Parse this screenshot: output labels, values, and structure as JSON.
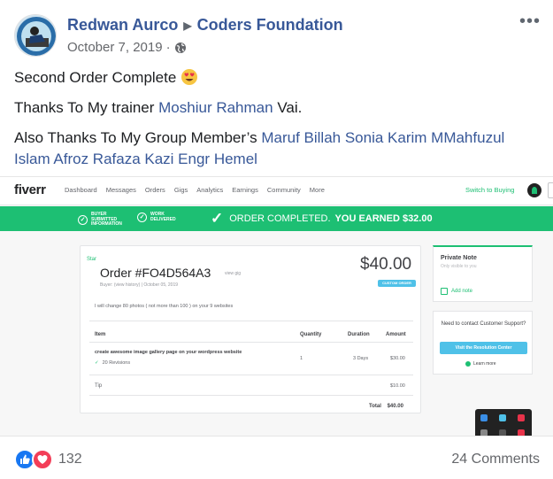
{
  "post": {
    "author": "Redwan Aurco",
    "group": "Coders Foundation",
    "date": "October 7, 2019",
    "separator": "·",
    "line1": "Second Order Complete",
    "line2_prefix": "Thanks To My trainer ",
    "line2_mention": "Moshiur Rahman",
    "line2_suffix": " Vai.",
    "line3_prefix": "Also Thanks To My Group Member’s ",
    "line3_mentions": "Maruf Billah Sonia Karim MMahfuzul Islam Afroz Rafaza Kazi Engr Hemel",
    "reaction_count": "132",
    "comments": "24 Comments"
  },
  "fiverr": {
    "logo": "fiverr",
    "nav": [
      "Dashboard",
      "Messages",
      "Orders",
      "Gigs",
      "Analytics",
      "Earnings",
      "Community",
      "More"
    ],
    "switch": "Switch to Buying",
    "step1": "BUYER SUBMITTED INFORMATION",
    "step2": "WORK DELIVERED",
    "completed": "ORDER COMPLETED.",
    "earned": "YOU EARNED $32.00",
    "star": "Star",
    "order": "Order #FO4D564A3",
    "view_gig": "view gig",
    "buyer": "Buyer: (view history) | October 05, 2019",
    "price": "$40.00",
    "badge": "CUSTOM ORDER",
    "description": "I will change 80 photos ( not more than 100 ) on your 9 websites",
    "headers": {
      "item": "Item",
      "quantity": "Quantity",
      "duration": "Duration",
      "amount": "Amount"
    },
    "row": {
      "item": "create awesome image gallery page on your wordpress website",
      "revisions": "20 Revisions",
      "quantity": "1",
      "duration": "3 Days",
      "amount": "$30.00"
    },
    "tip_label": "Tip",
    "tip_amount": "$10.00",
    "total_label": "Total",
    "total_amount": "$40.00",
    "note_title": "Private Note",
    "note_sub": "Only visible to you",
    "note_add": "Add note",
    "support_q": "Need to contact Customer Support?",
    "support_btn": "Visit the Resolution Center",
    "learn_more": "Learn more"
  },
  "colors": {
    "link": "#385898",
    "fiverr_green": "#1dbf73",
    "fiverr_blue": "#4fc1e8",
    "like_blue": "#1877f2",
    "love_red": "#f33e58"
  },
  "icons": [
    "avatar",
    "play-arrow-icon",
    "globe-icon",
    "more-options-icon",
    "heart-eyes-emoji",
    "check-icon",
    "like-icon",
    "love-icon"
  ]
}
